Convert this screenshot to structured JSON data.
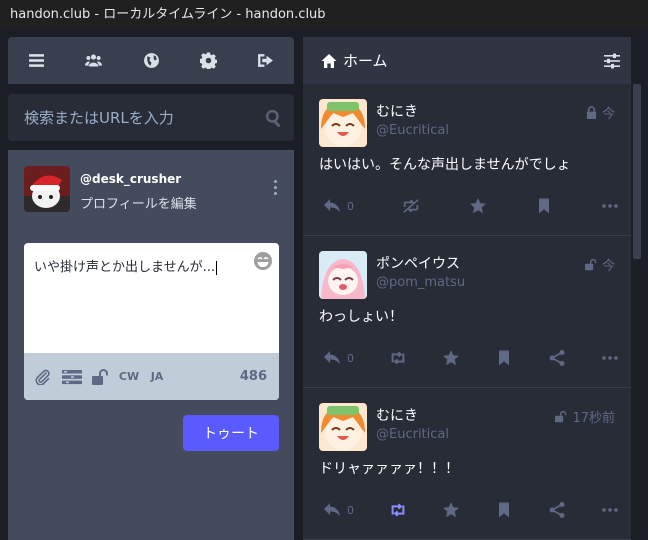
{
  "window": {
    "title": "handon.club - ローカルタイムライン - handon.club"
  },
  "nav": {
    "items": [
      {
        "icon": "bars-icon"
      },
      {
        "icon": "users-icon"
      },
      {
        "icon": "globe-icon"
      },
      {
        "icon": "gear-icon"
      },
      {
        "icon": "sign-out-icon"
      }
    ]
  },
  "search": {
    "placeholder": "検索またはURLを入力"
  },
  "account": {
    "handle": "@desk_crusher",
    "edit_label": "プロフィールを編集"
  },
  "compose": {
    "text": "いや掛け声とか出しませんが...",
    "cw_label": "CW",
    "lang_label": "JA",
    "char_count": "486",
    "toot_label": "トゥート"
  },
  "column": {
    "title": "ホーム"
  },
  "statuses": [
    {
      "display_name": "むにき",
      "handle": "@Eucritical",
      "time": "今",
      "visibility_icon": "lock-icon",
      "content": "はいはい。そんな声出しませんがでしょ",
      "reply_count": "0",
      "boost_icon": "boost-disabled-icon"
    },
    {
      "display_name": "ポンペイウス",
      "handle": "@pom_matsu",
      "time": "今",
      "visibility_icon": "unlock-icon",
      "content": "わっしょい！",
      "reply_count": "0",
      "boost_icon": "retweet-icon"
    },
    {
      "display_name": "むにき",
      "handle": "@Eucritical",
      "time": "17秒前",
      "visibility_icon": "unlock-icon",
      "content": "ドリャァァァァ！！！",
      "reply_count": "0",
      "boost_icon": "retweet-icon-active"
    }
  ],
  "colors": {
    "accent": "#595aff",
    "boosted": "#8c8dff",
    "muted": "#606984"
  }
}
